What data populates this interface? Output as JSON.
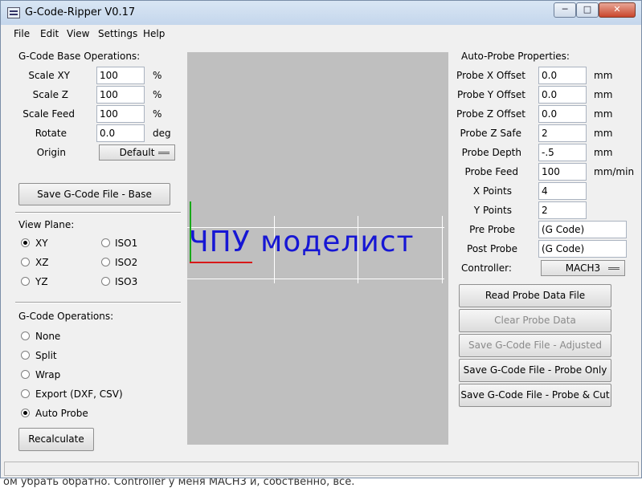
{
  "window": {
    "title": "G-Code-Ripper V0.17",
    "controls": {
      "minimize": "─",
      "maximize": "□",
      "close": "✕"
    }
  },
  "menu": [
    "File",
    "Edit",
    "View",
    "Settings",
    "Help"
  ],
  "base_ops": {
    "heading": "G-Code Base Operations:",
    "fields": [
      {
        "label": "Scale XY",
        "value": "100",
        "unit": "%"
      },
      {
        "label": "Scale Z",
        "value": "100",
        "unit": "%"
      },
      {
        "label": "Scale Feed",
        "value": "100",
        "unit": "%"
      },
      {
        "label": "Rotate",
        "value": "0.0",
        "unit": "deg"
      }
    ],
    "origin_label": "Origin",
    "origin_value": "Default",
    "save_button": "Save G-Code File - Base"
  },
  "view_plane": {
    "heading": "View Plane:",
    "options": [
      {
        "label": "XY",
        "checked": true
      },
      {
        "label": "ISO1",
        "checked": false
      },
      {
        "label": "XZ",
        "checked": false
      },
      {
        "label": "ISO2",
        "checked": false
      },
      {
        "label": "YZ",
        "checked": false
      },
      {
        "label": "ISO3",
        "checked": false
      }
    ]
  },
  "gcode_ops": {
    "heading": "G-Code Operations:",
    "options": [
      {
        "label": "None",
        "checked": false
      },
      {
        "label": "Split",
        "checked": false
      },
      {
        "label": "Wrap",
        "checked": false
      },
      {
        "label": "Export (DXF, CSV)",
        "checked": false
      },
      {
        "label": "Auto Probe",
        "checked": true
      }
    ],
    "recalculate_button": "Recalculate"
  },
  "preview": {
    "text": "ЧПУ моделист"
  },
  "auto_probe": {
    "heading": "Auto-Probe Properties:",
    "fields": [
      {
        "label": "Probe X Offset",
        "value": "0.0",
        "unit": "mm"
      },
      {
        "label": "Probe Y Offset",
        "value": "0.0",
        "unit": "mm"
      },
      {
        "label": "Probe Z Offset",
        "value": "0.0",
        "unit": "mm"
      },
      {
        "label": "Probe Z Safe",
        "value": "2",
        "unit": "mm"
      },
      {
        "label": "Probe Depth",
        "value": "-.5",
        "unit": "mm"
      },
      {
        "label": "Probe Feed",
        "value": "100",
        "unit": "mm/min"
      },
      {
        "label": "X Points",
        "value": "4",
        "unit": ""
      },
      {
        "label": "Y Points",
        "value": "2",
        "unit": ""
      },
      {
        "label": "Pre Probe",
        "value": "(G Code)",
        "unit": ""
      },
      {
        "label": "Post Probe",
        "value": "(G Code)",
        "unit": ""
      }
    ],
    "controller_label": "Controller:",
    "controller_value": "MACH3",
    "buttons": [
      {
        "label": "Read Probe Data File",
        "enabled": true
      },
      {
        "label": "Clear Probe Data",
        "enabled": false
      },
      {
        "label": "Save G-Code File - Adjusted",
        "enabled": false
      },
      {
        "label": "Save G-Code File - Probe Only",
        "enabled": true
      },
      {
        "label": "Save G-Code File - Probe & Cut",
        "enabled": true
      }
    ]
  },
  "background_page": {
    "bottom_text": "ом убрать обратно. Controller у меня MACH3 и, собственно, всё."
  },
  "colors": {
    "preview_text": "#1616d4",
    "canvas": "#bfbfbf",
    "axis_x": "#d81818",
    "axis_y": "#18a818"
  }
}
